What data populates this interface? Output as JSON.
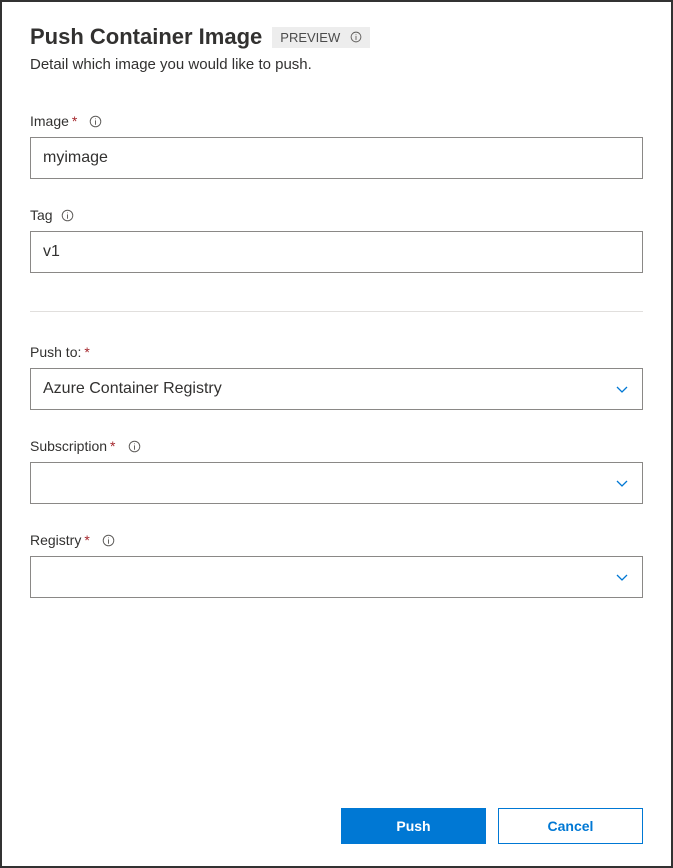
{
  "header": {
    "title": "Push Container Image",
    "badge": "PREVIEW",
    "subtitle": "Detail which image you would like to push."
  },
  "fields": {
    "image": {
      "label": "Image",
      "value": "myimage"
    },
    "tag": {
      "label": "Tag",
      "value": "v1"
    },
    "pushTo": {
      "label": "Push to:",
      "value": "Azure Container Registry"
    },
    "subscription": {
      "label": "Subscription",
      "value": ""
    },
    "registry": {
      "label": "Registry",
      "value": ""
    }
  },
  "buttons": {
    "push": "Push",
    "cancel": "Cancel"
  }
}
